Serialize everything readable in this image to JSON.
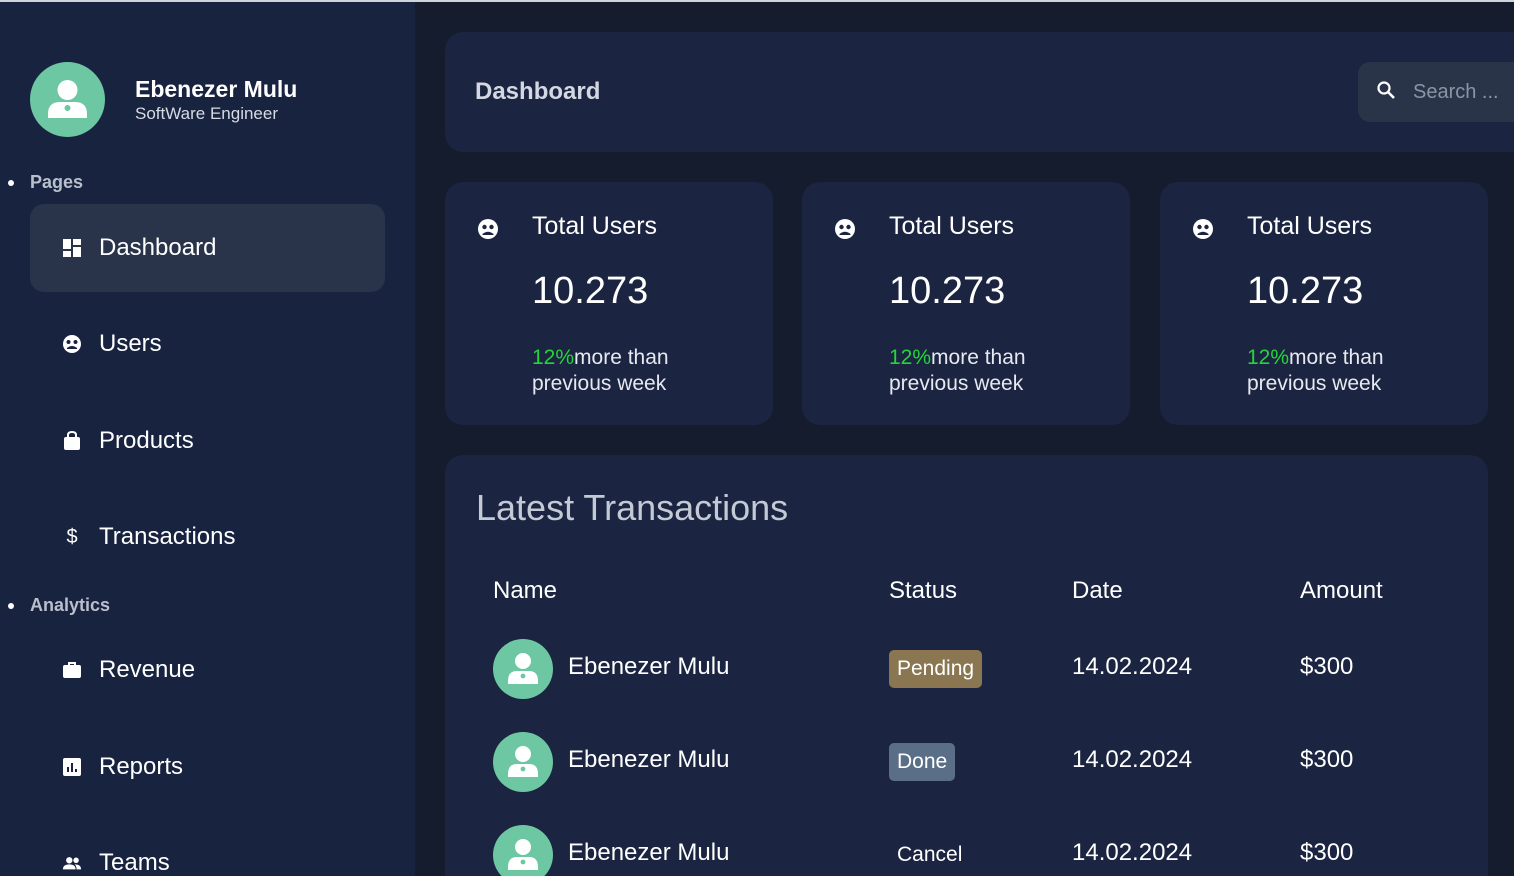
{
  "profile": {
    "name": "Ebenezer Mulu",
    "role": "SoftWare Engineer"
  },
  "sidebar": {
    "sections": [
      {
        "label": "Pages"
      },
      {
        "label": "Analytics"
      }
    ],
    "items": [
      {
        "label": "Dashboard",
        "icon": "dashboard-icon",
        "active": true
      },
      {
        "label": "Users",
        "icon": "users-icon"
      },
      {
        "label": "Products",
        "icon": "shopping-bag-icon"
      },
      {
        "label": "Transactions",
        "icon": "dollar-icon"
      },
      {
        "label": "Revenue",
        "icon": "briefcase-icon"
      },
      {
        "label": "Reports",
        "icon": "report-icon"
      },
      {
        "label": "Teams",
        "icon": "people-icon"
      }
    ]
  },
  "header": {
    "title": "Dashboard",
    "search_placeholder": "Search ..."
  },
  "stats": [
    {
      "title": "Total Users",
      "value": "10.273",
      "pct": "12%",
      "note": "more than previous week"
    },
    {
      "title": "Total Users",
      "value": "10.273",
      "pct": "12%",
      "note": "more than previous week"
    },
    {
      "title": "Total Users",
      "value": "10.273",
      "pct": "12%",
      "note": "more than previous week"
    }
  ],
  "transactions": {
    "title": "Latest Transactions",
    "headers": [
      "Name",
      "Status",
      "Date",
      "Amount"
    ],
    "rows": [
      {
        "name": "Ebenezer Mulu",
        "status": "Pending",
        "date": "14.02.2024",
        "amount": "$300"
      },
      {
        "name": "Ebenezer Mulu",
        "status": "Done",
        "date": "14.02.2024",
        "amount": "$300"
      },
      {
        "name": "Ebenezer Mulu",
        "status": "Cancel",
        "date": "14.02.2024",
        "amount": "$300"
      }
    ]
  },
  "colors": {
    "background": "#141c2e",
    "sidebar": "#182340",
    "card": "#1b2440",
    "accent_green": "#22d63a",
    "avatar": "#6dc7a2",
    "pending": "#8a7650",
    "done": "#5a6f87"
  }
}
